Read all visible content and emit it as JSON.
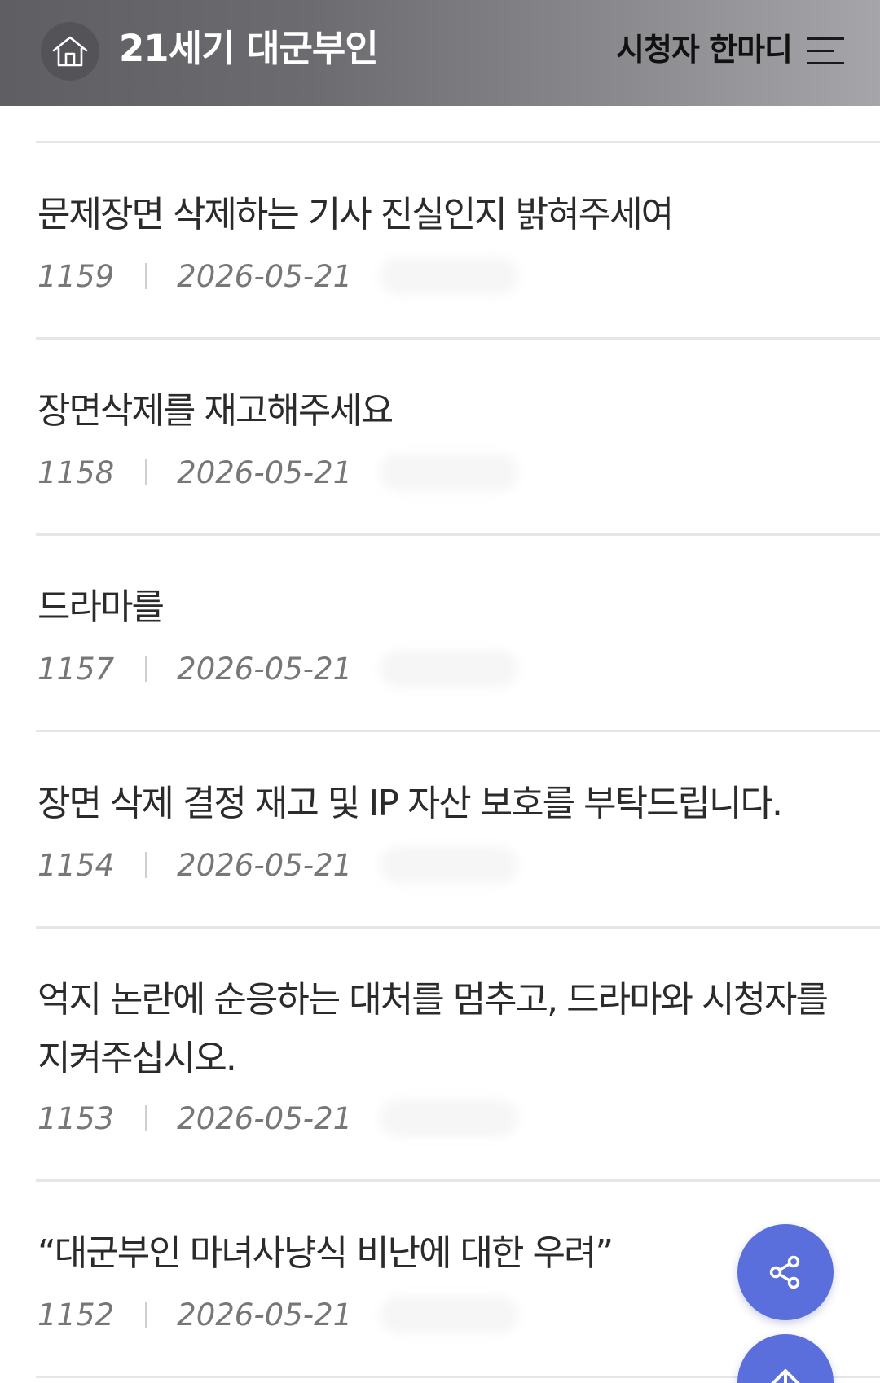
{
  "header": {
    "title": "21세기 대군부인",
    "board_title": "시청자 한마디",
    "home_icon": "home-icon",
    "menu_icon": "hamburger-menu-icon"
  },
  "posts": [
    {
      "title": "문제장면 삭제하는 기사 진실인지 밝혀주세여",
      "number": "1159",
      "date": "2026-05-21"
    },
    {
      "title": "장면삭제를 재고해주세요",
      "number": "1158",
      "date": "2026-05-21"
    },
    {
      "title": "드라마를",
      "number": "1157",
      "date": "2026-05-21"
    },
    {
      "title": "장면 삭제 결정 재고 및 IP 자산 보호를 부탁드립니다.",
      "number": "1154",
      "date": "2026-05-21"
    },
    {
      "title": "억지 논란에 순응하는 대처를 멈추고, 드라마와 시청자를 지켜주십시오.",
      "number": "1153",
      "date": "2026-05-21"
    },
    {
      "title": "“대군부인 마녀사냥식 비난에 대한 우려”",
      "number": "1152",
      "date": "2026-05-21"
    }
  ],
  "floating": {
    "share_icon": "share-icon",
    "top_icon": "arrow-up-icon"
  },
  "colors": {
    "header_dark": "#5f5e63",
    "header_light": "#a6a5a9",
    "fab": "#5b6fdc",
    "divider": "#e6e6e6",
    "title_text": "#2b2b2b",
    "meta_text": "#777777"
  }
}
